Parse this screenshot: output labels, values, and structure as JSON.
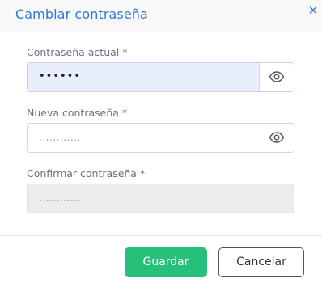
{
  "dialog": {
    "title": "Cambiar contraseña",
    "close_icon": "close-icon"
  },
  "fields": {
    "current": {
      "label": "Contraseña actual *",
      "value": "••••••",
      "toggle_icon": "eye-icon"
    },
    "new": {
      "label": "Nueva contraseña *",
      "placeholder": "............",
      "toggle_icon": "eye-icon"
    },
    "confirm": {
      "label": "Confirmar contraseña *",
      "placeholder": "............"
    }
  },
  "actions": {
    "save_label": "Guardar",
    "cancel_label": "Cancelar"
  },
  "colors": {
    "accent": "#2f78d6",
    "primary_button": "#27c07a",
    "active_field": "#e8eefc",
    "disabled_field": "#ececec"
  }
}
